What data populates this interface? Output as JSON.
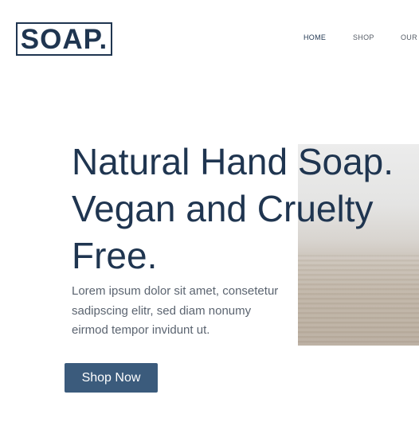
{
  "brand": {
    "logo_text": "SOAP."
  },
  "nav": {
    "items": [
      {
        "label": "HOME",
        "active": true
      },
      {
        "label": "SHOP",
        "active": false
      },
      {
        "label": "OUR S",
        "active": false
      }
    ]
  },
  "hero": {
    "headline_lines": [
      "Natural Hand Soap.",
      "Vegan and Cruelty",
      "Free."
    ],
    "body_lines": [
      "Lorem ipsum dolor sit amet, consetetur",
      "sadipscing elitr, sed diam nonumy",
      "eirmod tempor invidunt ut."
    ],
    "cta_label": "Shop Now"
  },
  "colors": {
    "primary_text": "#1f3550",
    "body_text": "#5b6470",
    "button_bg": "#3b5b7c",
    "button_text": "#ffffff",
    "background": "#ffffff"
  }
}
